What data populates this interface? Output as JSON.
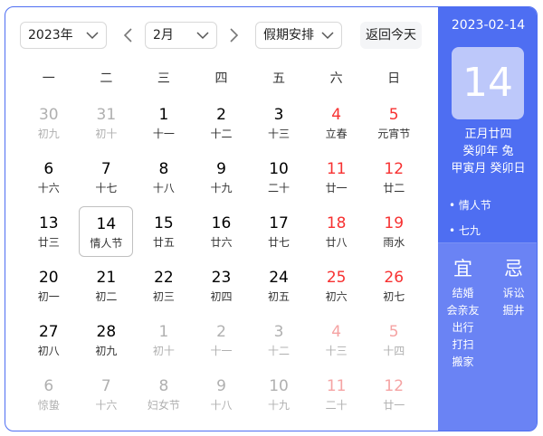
{
  "toolbar": {
    "year": "2023年",
    "month": "2月",
    "holiday": "假期安排",
    "today": "返回今天"
  },
  "weekdays": [
    "一",
    "二",
    "三",
    "四",
    "五",
    "六",
    "日"
  ],
  "weeks": [
    [
      [
        "30",
        "初九",
        "other"
      ],
      [
        "31",
        "初十",
        "other"
      ],
      [
        "1",
        "十一",
        ""
      ],
      [
        "2",
        "十二",
        ""
      ],
      [
        "3",
        "十三",
        ""
      ],
      [
        "4",
        "立春",
        "weekend"
      ],
      [
        "5",
        "元宵节",
        "weekend"
      ]
    ],
    [
      [
        "6",
        "十六",
        ""
      ],
      [
        "7",
        "十七",
        ""
      ],
      [
        "8",
        "十八",
        ""
      ],
      [
        "9",
        "十九",
        ""
      ],
      [
        "10",
        "二十",
        ""
      ],
      [
        "11",
        "廿一",
        "weekend"
      ],
      [
        "12",
        "廿二",
        "weekend"
      ]
    ],
    [
      [
        "13",
        "廿三",
        ""
      ],
      [
        "14",
        "情人节",
        "selected"
      ],
      [
        "15",
        "廿五",
        ""
      ],
      [
        "16",
        "廿六",
        ""
      ],
      [
        "17",
        "廿七",
        ""
      ],
      [
        "18",
        "廿八",
        "weekend"
      ],
      [
        "19",
        "雨水",
        "weekend"
      ]
    ],
    [
      [
        "20",
        "初一",
        ""
      ],
      [
        "21",
        "初二",
        ""
      ],
      [
        "22",
        "初三",
        ""
      ],
      [
        "23",
        "初四",
        ""
      ],
      [
        "24",
        "初五",
        ""
      ],
      [
        "25",
        "初六",
        "weekend"
      ],
      [
        "26",
        "初七",
        "weekend"
      ]
    ],
    [
      [
        "27",
        "初八",
        ""
      ],
      [
        "28",
        "初九",
        ""
      ],
      [
        "1",
        "初十",
        "other"
      ],
      [
        "2",
        "十一",
        "other"
      ],
      [
        "3",
        "十二",
        "other"
      ],
      [
        "4",
        "十三",
        "other weekend"
      ],
      [
        "5",
        "十四",
        "other weekend"
      ]
    ],
    [
      [
        "6",
        "惊蛰",
        "other"
      ],
      [
        "7",
        "十六",
        "other"
      ],
      [
        "8",
        "妇女节",
        "other"
      ],
      [
        "9",
        "十八",
        "other"
      ],
      [
        "10",
        "十九",
        "other"
      ],
      [
        "11",
        "二十",
        "other weekend"
      ],
      [
        "12",
        "廿一",
        "other weekend"
      ]
    ]
  ],
  "panel": {
    "date": "2023-02-14",
    "day": "14",
    "lunar": "正月廿四",
    "ganzhi_year": "癸卯年 兔",
    "ganzhi_month_day": "甲寅月 癸卯日",
    "festivals": [
      "• 情人节",
      "• 七九"
    ],
    "yi_label": "宜",
    "ji_label": "忌",
    "yi": [
      "结婚",
      "会亲友",
      "出行",
      "打扫",
      "搬家"
    ],
    "ji": [
      "诉讼",
      "掘井"
    ]
  }
}
